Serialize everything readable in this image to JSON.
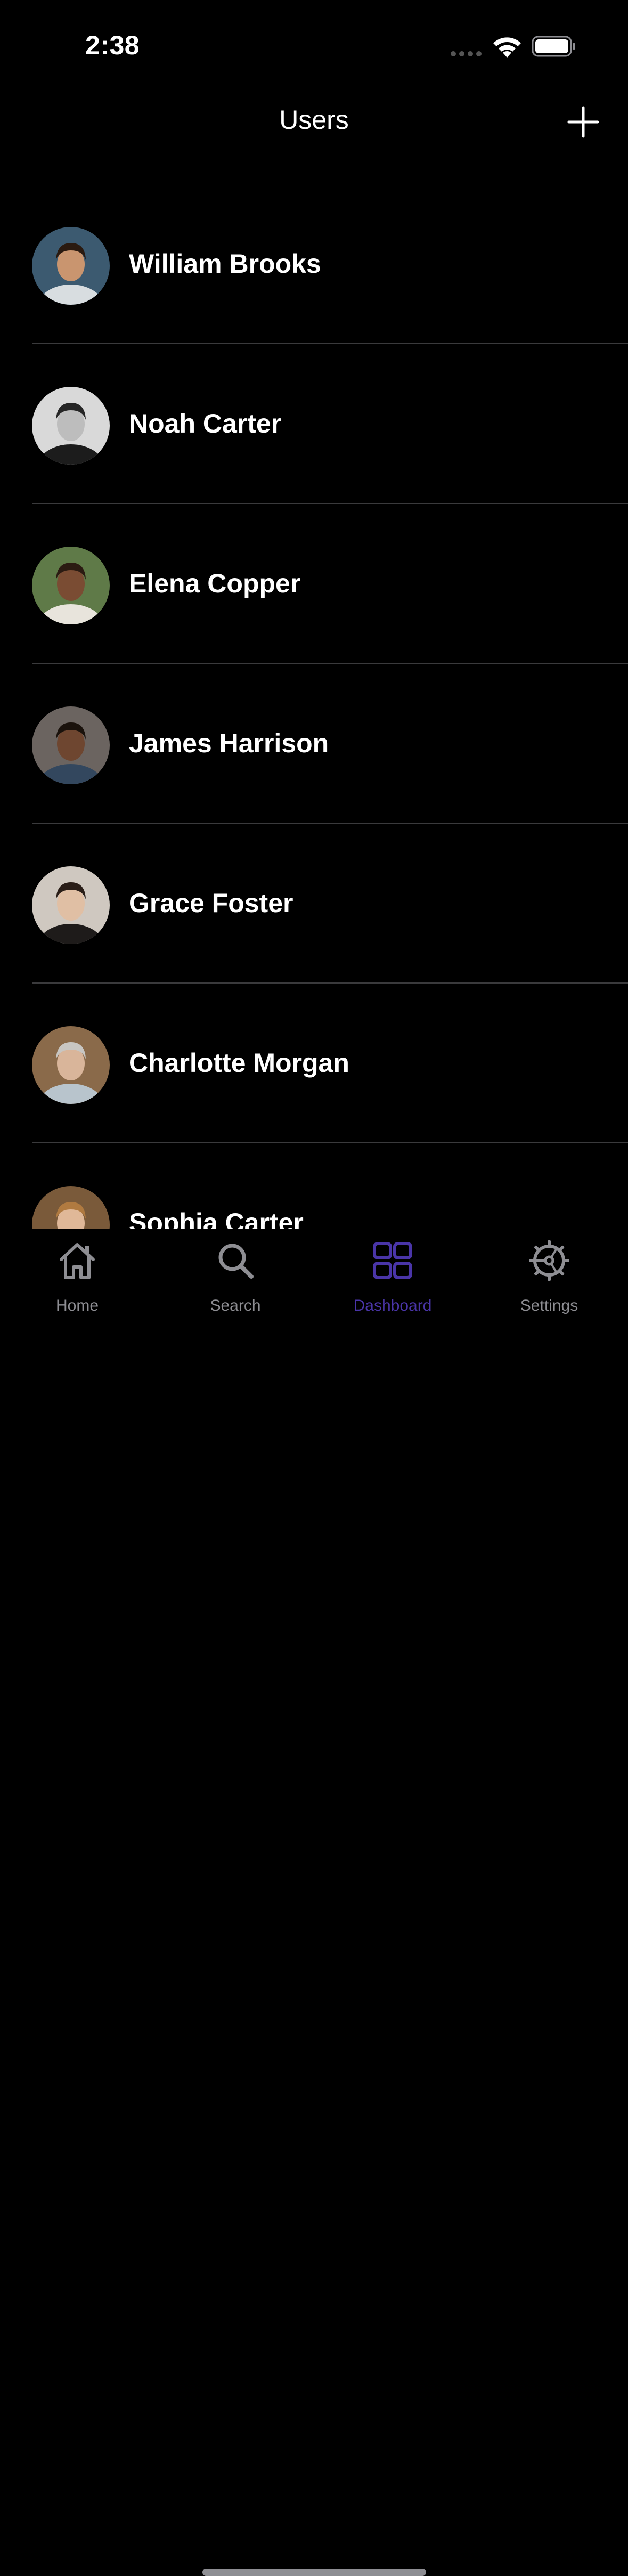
{
  "status_bar": {
    "time": "2:38"
  },
  "nav": {
    "title": "Users",
    "add_icon": "plus-icon"
  },
  "users": [
    {
      "name": "William Brooks",
      "avatar_bg": "#3c5a70",
      "skin": "#c9956f",
      "hair": "#2a1a10",
      "shirt": "#d8dde0"
    },
    {
      "name": "Noah Carter",
      "avatar_bg": "#d9d9d9",
      "skin": "#bdbdbd",
      "hair": "#262626",
      "shirt": "#1c1c1c"
    },
    {
      "name": "Elena Copper",
      "avatar_bg": "#5f7a48",
      "skin": "#7a4c33",
      "hair": "#2b1b12",
      "shirt": "#e8e4dc"
    },
    {
      "name": "James Harrison",
      "avatar_bg": "#6b6460",
      "skin": "#6e4630",
      "hair": "#1a120c",
      "shirt": "#33475e"
    },
    {
      "name": "Grace Foster",
      "avatar_bg": "#cfc8c0",
      "skin": "#e0bfa4",
      "hair": "#2a1e18",
      "shirt": "#1e1b1a"
    },
    {
      "name": "Charlotte Morgan",
      "avatar_bg": "#8a6a4a",
      "skin": "#d9b59a",
      "hair": "#c8c6c2",
      "shirt": "#b8c4cc"
    },
    {
      "name": "Sophia Carter",
      "avatar_bg": "#7a5a3a",
      "skin": "#e0b898",
      "hair": "#b07a40",
      "shirt": "#c04040"
    }
  ],
  "tabs": [
    {
      "label": "Home",
      "icon": "house-icon",
      "active": false
    },
    {
      "label": "Search",
      "icon": "magnifier-icon",
      "active": false
    },
    {
      "label": "Dashboard",
      "icon": "grid-icon",
      "active": true
    },
    {
      "label": "Settings",
      "icon": "gear-icon",
      "active": false
    }
  ],
  "colors": {
    "background": "#000000",
    "accent": "#4a35a8",
    "tab_inactive": "#8e8e93",
    "divider": "#3a3a3c"
  }
}
